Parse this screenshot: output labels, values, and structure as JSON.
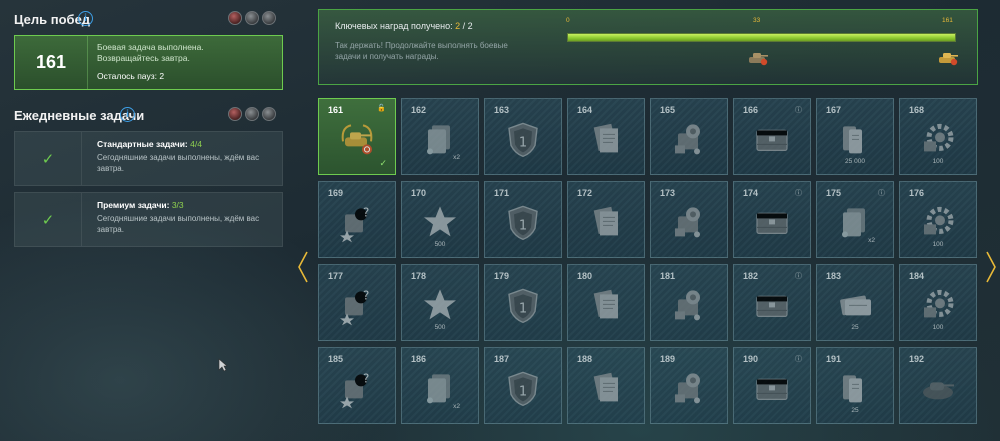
{
  "left": {
    "win_goal": {
      "title": "Цель побед",
      "value": "161",
      "line1": "Боевая задача выполнена.",
      "line2": "Возвращайтесь завтра.",
      "pause": "Осталось пауз: 2"
    },
    "daily": {
      "title": "Ежедневные задачи",
      "standard": {
        "title": "Стандартные задачи:",
        "count": "4/4",
        "desc": "Сегодняшние задачи выполнены, ждём вас завтра."
      },
      "premium": {
        "title": "Премиум задачи:",
        "count": "3/3",
        "desc": "Сегодняшние задачи выполнены, ждём вас завтра."
      }
    }
  },
  "progress": {
    "label": "Ключевых наград получено:",
    "got": "2",
    "total": "/ 2",
    "subtitle": "Так держать! Продолжайте выполнять боевые задачи и получать награды.",
    "ticks": [
      "0",
      "33",
      "161"
    ],
    "fill_fraction": 1.0
  },
  "cells": [
    {
      "n": "161",
      "icon": "tank-reward-icon",
      "current": true
    },
    {
      "n": "162",
      "icon": "booster-icon",
      "count": "x2"
    },
    {
      "n": "163",
      "icon": "shield-rank-icon"
    },
    {
      "n": "164",
      "icon": "document-icon"
    },
    {
      "n": "165",
      "icon": "equipment-icon"
    },
    {
      "n": "166",
      "icon": "crate-icon",
      "info": true
    },
    {
      "n": "167",
      "icon": "credits-icon",
      "count": "25 000"
    },
    {
      "n": "168",
      "icon": "gear-icon",
      "count": "100"
    },
    {
      "n": "169",
      "icon": "mystery-crew-icon"
    },
    {
      "n": "170",
      "icon": "star-icon",
      "count": "500"
    },
    {
      "n": "171",
      "icon": "shield-rank-icon"
    },
    {
      "n": "172",
      "icon": "document-icon"
    },
    {
      "n": "173",
      "icon": "equipment-icon"
    },
    {
      "n": "174",
      "icon": "crate-icon",
      "info": true
    },
    {
      "n": "175",
      "icon": "booster-icon",
      "count": "x2",
      "info": true
    },
    {
      "n": "176",
      "icon": "gear-icon",
      "count": "100"
    },
    {
      "n": "177",
      "icon": "mystery-crew-icon"
    },
    {
      "n": "178",
      "icon": "star-icon",
      "count": "500"
    },
    {
      "n": "179",
      "icon": "shield-rank-icon"
    },
    {
      "n": "180",
      "icon": "document-icon"
    },
    {
      "n": "181",
      "icon": "equipment-icon"
    },
    {
      "n": "182",
      "icon": "crate-icon",
      "info": true
    },
    {
      "n": "183",
      "icon": "ticket-icon",
      "count": "25"
    },
    {
      "n": "184",
      "icon": "gear-icon",
      "count": "100"
    },
    {
      "n": "185",
      "icon": "mystery-crew-icon"
    },
    {
      "n": "186",
      "icon": "booster-icon",
      "count": "x2"
    },
    {
      "n": "187",
      "icon": "shield-rank-icon"
    },
    {
      "n": "188",
      "icon": "document-icon"
    },
    {
      "n": "189",
      "icon": "equipment-icon"
    },
    {
      "n": "190",
      "icon": "crate-icon",
      "info": true
    },
    {
      "n": "191",
      "icon": "credits-icon",
      "count": "25"
    },
    {
      "n": "192",
      "icon": "tank-silhouette-icon"
    }
  ],
  "colors": {
    "accent_green": "#6ecb4f",
    "accent_yellow": "#e8b938",
    "info_blue": "#3ea0e8"
  }
}
